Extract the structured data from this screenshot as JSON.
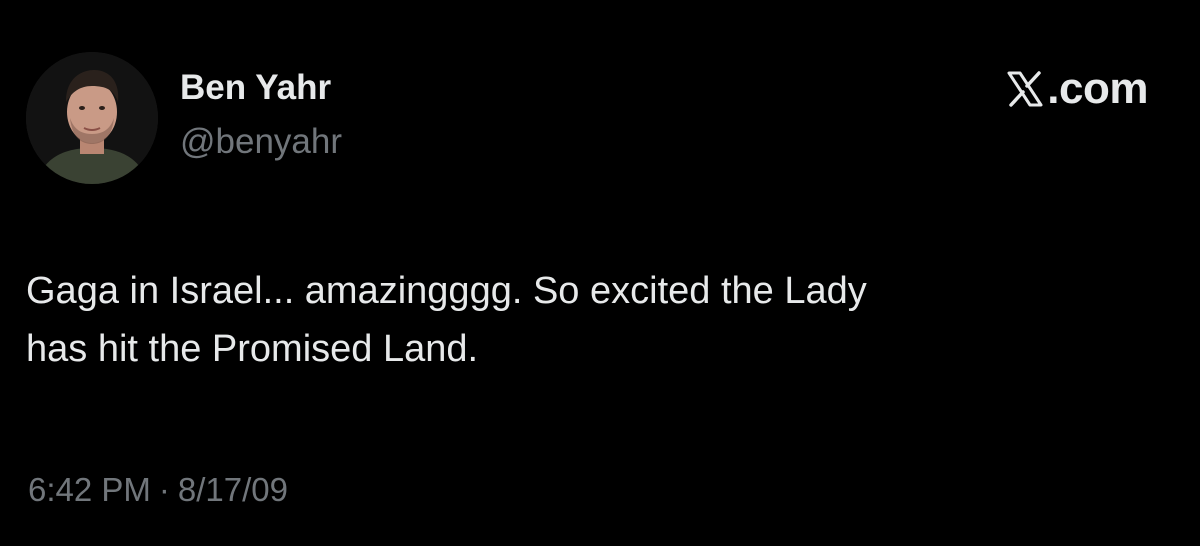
{
  "author": {
    "display_name": "Ben Yahr",
    "handle": "@benyahr"
  },
  "brand": {
    "icon": "x-logo-icon",
    "text": ".com"
  },
  "tweet": {
    "lines": [
      "Gaga in Israel... amazingggg. So excited the Lady",
      "has hit the Promised Land."
    ],
    "time": "6:42 PM",
    "separator": "·",
    "date": "8/17/09"
  },
  "colors": {
    "background": "#000000",
    "primary_text": "#e7e9ea",
    "secondary_text": "#71767b"
  }
}
